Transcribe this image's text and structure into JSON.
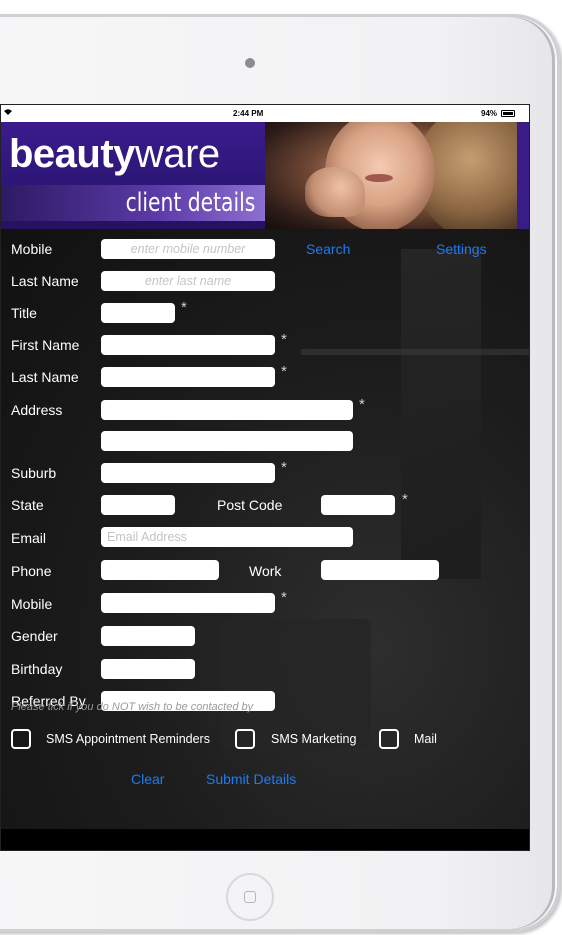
{
  "status_bar": {
    "time": "2:44 PM",
    "battery": "94%",
    "wifi_icon": "wifi-icon",
    "battery_icon": "battery-icon"
  },
  "header": {
    "brand_bold": "beauty",
    "brand_regular": "ware",
    "subtitle": "client details"
  },
  "search_bar": {
    "mobile_label": "Mobile",
    "mobile_placeholder": "enter mobile number",
    "last_name_label": "Last Name",
    "last_name_placeholder": "enter last name",
    "search_link": "Search",
    "settings_link": "Settings"
  },
  "form": {
    "title_label": "Title",
    "first_name_label": "First Name",
    "last_name_label": "Last Name",
    "address_label": "Address",
    "suburb_label": "Suburb",
    "state_label": "State",
    "post_code_label": "Post Code",
    "email_label": "Email",
    "email_placeholder": "Email Address",
    "phone_label": "Phone",
    "work_label": "Work",
    "mobile_label": "Mobile",
    "gender_label": "Gender",
    "birthday_label": "Birthday",
    "referred_by_label": "Referred By",
    "required_mark": "*"
  },
  "contact_preferences": {
    "note": "Please tick if you do NOT wish to be contacted by",
    "options": [
      "SMS Appointment Reminders",
      "SMS Marketing",
      "Mail"
    ]
  },
  "actions": {
    "clear": "Clear",
    "submit": "Submit Details"
  },
  "colors": {
    "brand_purple": "#2c1676",
    "link_blue": "#1e7bf0"
  }
}
